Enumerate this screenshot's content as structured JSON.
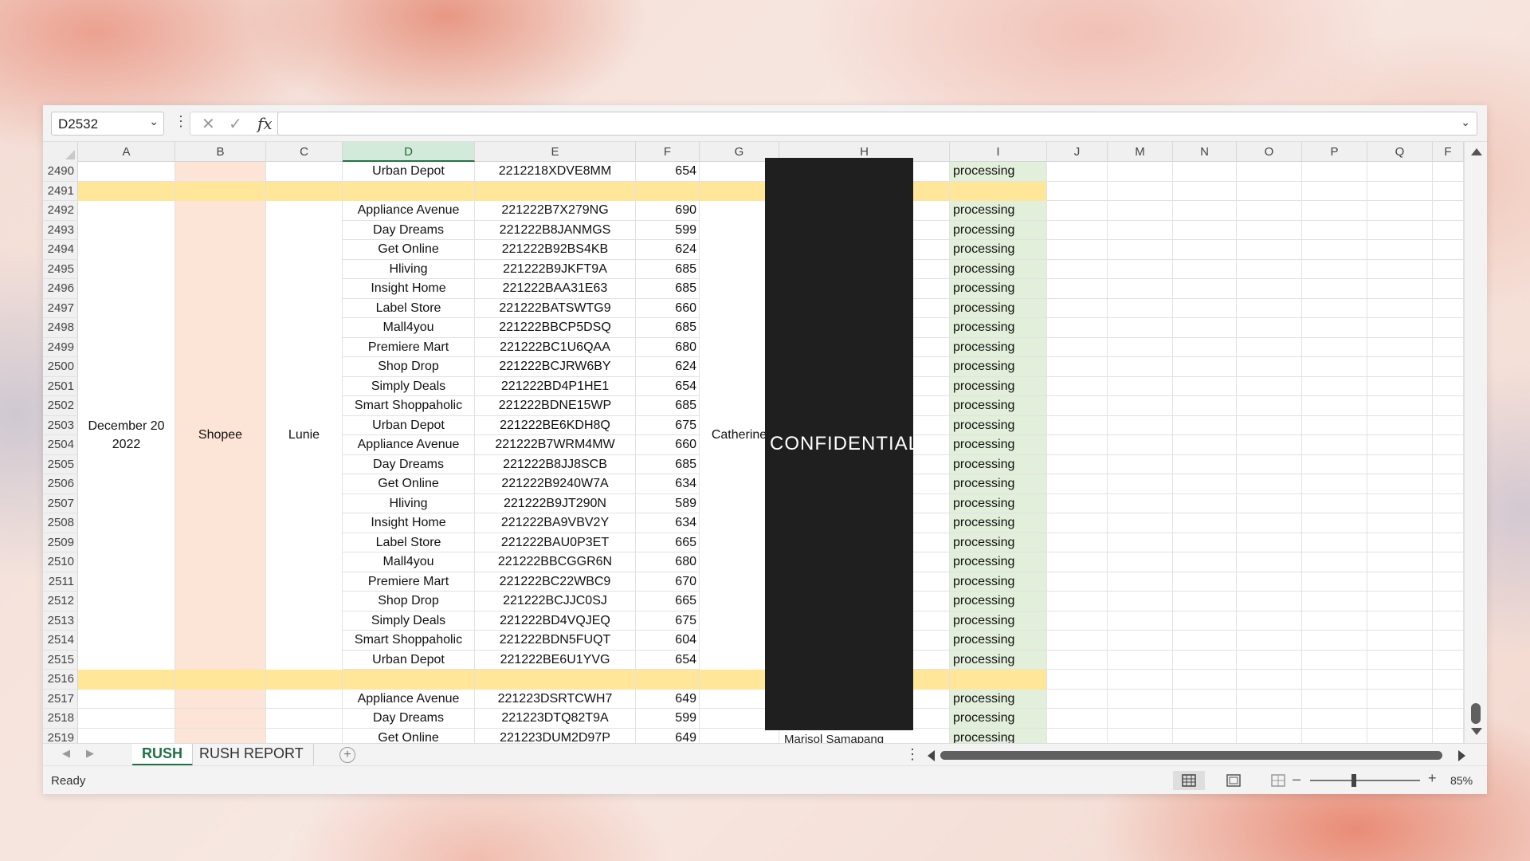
{
  "formula_bar": {
    "name_box": "D2532",
    "fx_label": "fx",
    "formula": ""
  },
  "columns": [
    "A",
    "B",
    "C",
    "D",
    "E",
    "F",
    "G",
    "H",
    "I",
    "J",
    "M",
    "N",
    "O",
    "P",
    "Q",
    "F"
  ],
  "active_column": "D",
  "merged": {
    "date": "December 20 2022",
    "platform": "Shopee",
    "name": "Lunie",
    "assignee": "Catherine"
  },
  "redaction_label": "CONFIDENTIAL",
  "peek_name": "Marisol Samapang",
  "rows": [
    {
      "n": "2490",
      "store": "Urban Depot",
      "order": "2212218XDVE8MM",
      "amount": "654",
      "status": "processing"
    },
    {
      "n": "2491",
      "sep": true
    },
    {
      "n": "2492",
      "store": "Appliance Avenue",
      "order": "221222B7X279NG",
      "amount": "690",
      "status": "processing"
    },
    {
      "n": "2493",
      "store": "Day Dreams",
      "order": "221222B8JANMGS",
      "amount": "599",
      "status": "processing"
    },
    {
      "n": "2494",
      "store": "Get Online",
      "order": "221222B92BS4KB",
      "amount": "624",
      "status": "processing"
    },
    {
      "n": "2495",
      "store": "Hliving",
      "order": "221222B9JKFT9A",
      "amount": "685",
      "status": "processing"
    },
    {
      "n": "2496",
      "store": "Insight Home",
      "order": "221222BAA31E63",
      "amount": "685",
      "status": "processing"
    },
    {
      "n": "2497",
      "store": "Label Store",
      "order": "221222BATSWTG9",
      "amount": "660",
      "status": "processing"
    },
    {
      "n": "2498",
      "store": "Mall4you",
      "order": "221222BBCP5DSQ",
      "amount": "685",
      "status": "processing"
    },
    {
      "n": "2499",
      "store": "Premiere Mart",
      "order": "221222BC1U6QAA",
      "amount": "680",
      "status": "processing"
    },
    {
      "n": "2500",
      "store": "Shop Drop",
      "order": "221222BCJRW6BY",
      "amount": "624",
      "status": "processing"
    },
    {
      "n": "2501",
      "store": "Simply Deals",
      "order": "221222BD4P1HE1",
      "amount": "654",
      "status": "processing"
    },
    {
      "n": "2502",
      "store": "Smart Shoppaholic",
      "order": "221222BDNE15WP",
      "amount": "685",
      "status": "processing"
    },
    {
      "n": "2503",
      "store": "Urban Depot",
      "order": "221222BE6KDH8Q",
      "amount": "675",
      "status": "processing"
    },
    {
      "n": "2504",
      "store": "Appliance Avenue",
      "order": "221222B7WRM4MW",
      "amount": "660",
      "status": "processing"
    },
    {
      "n": "2505",
      "store": "Day Dreams",
      "order": "221222B8JJ8SCB",
      "amount": "685",
      "status": "processing"
    },
    {
      "n": "2506",
      "store": "Get Online",
      "order": "221222B9240W7A",
      "amount": "634",
      "status": "processing"
    },
    {
      "n": "2507",
      "store": "Hliving",
      "order": "221222B9JT290N",
      "amount": "589",
      "status": "processing"
    },
    {
      "n": "2508",
      "store": "Insight Home",
      "order": "221222BA9VBV2Y",
      "amount": "634",
      "status": "processing"
    },
    {
      "n": "2509",
      "store": "Label Store",
      "order": "221222BAU0P3ET",
      "amount": "665",
      "status": "processing"
    },
    {
      "n": "2510",
      "store": "Mall4you",
      "order": "221222BBCGGR6N",
      "amount": "680",
      "status": "processing"
    },
    {
      "n": "2511",
      "store": "Premiere Mart",
      "order": "221222BC22WBC9",
      "amount": "670",
      "status": "processing"
    },
    {
      "n": "2512",
      "store": "Shop Drop",
      "order": "221222BCJJC0SJ",
      "amount": "665",
      "status": "processing"
    },
    {
      "n": "2513",
      "store": "Simply Deals",
      "order": "221222BD4VQJEQ",
      "amount": "675",
      "status": "processing"
    },
    {
      "n": "2514",
      "store": "Smart Shoppaholic",
      "order": "221222BDN5FUQT",
      "amount": "604",
      "status": "processing"
    },
    {
      "n": "2515",
      "store": "Urban Depot",
      "order": "221222BE6U1YVG",
      "amount": "654",
      "status": "processing"
    },
    {
      "n": "2516",
      "sep": true
    },
    {
      "n": "2517",
      "store": "Appliance Avenue",
      "order": "221223DSRTCWH7",
      "amount": "649",
      "status": "processing"
    },
    {
      "n": "2518",
      "store": "Day Dreams",
      "order": "221223DTQ82T9A",
      "amount": "599",
      "status": "processing"
    },
    {
      "n": "2519",
      "store": "Get Online",
      "order": "221223DUM2D97P",
      "amount": "649",
      "status": "processing"
    }
  ],
  "sheet_tabs": [
    {
      "label": "RUSH",
      "active": true
    },
    {
      "label": "RUSH REPORT",
      "active": false
    }
  ],
  "status": {
    "text": "Ready",
    "zoom": "85%"
  },
  "colors": {
    "separator": "#ffe699",
    "column_b": "#fce4d6",
    "status_col": "#e2efda",
    "accent": "#217346"
  }
}
